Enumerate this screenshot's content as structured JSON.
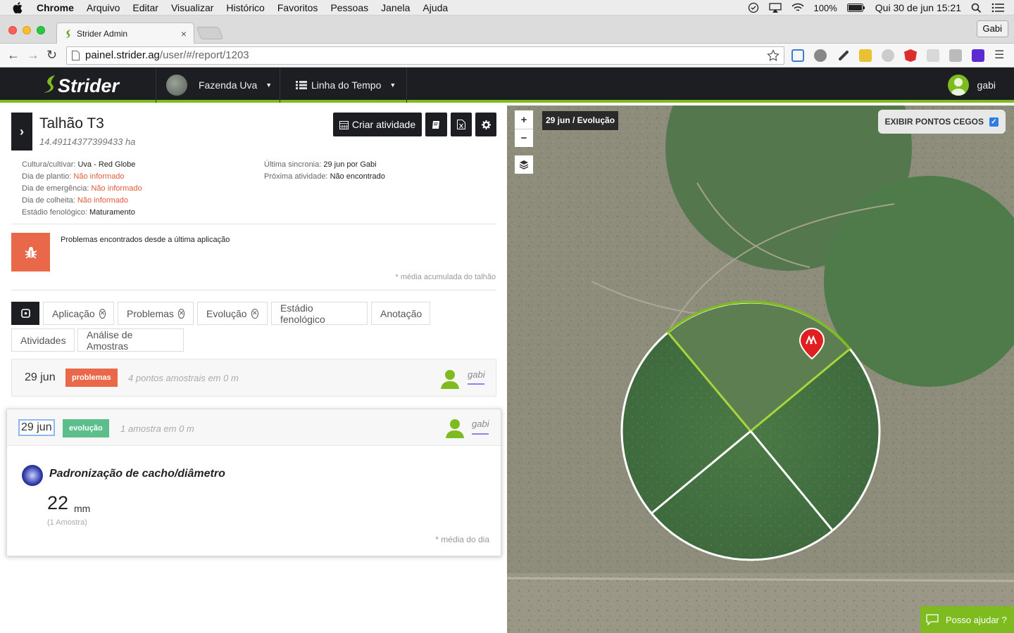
{
  "menubar": {
    "app": "Chrome",
    "items": [
      "Arquivo",
      "Editar",
      "Visualizar",
      "Histórico",
      "Favoritos",
      "Pessoas",
      "Janela",
      "Ajuda"
    ],
    "battery": "100%",
    "clock": "Qui 30 de jun  15:21"
  },
  "browser": {
    "tab_title": "Strider Admin",
    "profile": "Gabi",
    "url_host": "painel.strider.ag",
    "url_path": "/user/#/report/1203"
  },
  "header": {
    "brand": "Strider",
    "farm": "Fazenda Uva",
    "view": "Linha do Tempo",
    "user": "gabi",
    "accent": "#7dbb1f"
  },
  "plot": {
    "title": "Talhão T3",
    "area": "14.49114377399433 ha",
    "create_activity": "Criar atividade",
    "info_left": [
      {
        "label": "Cultura/cultivar:",
        "value": "Uva - Red Globe",
        "warn": false
      },
      {
        "label": "Dia de plantio:",
        "value": "Não informado",
        "warn": true
      },
      {
        "label": "Dia de emergência:",
        "value": "Não informado",
        "warn": true
      },
      {
        "label": "Dia de colheita:",
        "value": "Não informado",
        "warn": true
      },
      {
        "label": "Estádio fenológico:",
        "value": "Maturamento",
        "warn": false
      }
    ],
    "info_right": [
      {
        "label": "Última sincronia:",
        "value": "29 jun por Gabi"
      },
      {
        "label": "Próxima atividade:",
        "value": "Não encontrado"
      }
    ],
    "problems_title": "Problemas encontrados desde a última aplicação",
    "accum_note": "* média acumulada do talhão"
  },
  "filters": {
    "row1": [
      {
        "label": "Aplicação",
        "removable": true
      },
      {
        "label": "Problemas",
        "removable": true
      },
      {
        "label": "Evolução",
        "removable": true
      },
      {
        "label": "Estádio fenológico",
        "removable": false
      },
      {
        "label": "Anotação",
        "removable": false
      }
    ],
    "row2": [
      {
        "label": "Atividades",
        "removable": false
      },
      {
        "label": "Análise de Amostras",
        "removable": false
      }
    ]
  },
  "timeline": [
    {
      "date": "29 jun",
      "badge": "problemas",
      "badge_color": "#e9684a",
      "desc": "4 pontos amostrais em 0 m",
      "user": "gabi"
    },
    {
      "date": "29 jun",
      "badge": "evolução",
      "badge_color": "#5cbf8b",
      "desc": "1 amostra em 0 m",
      "user": "gabi",
      "metric": {
        "title": "Padronização de cacho/diâmetro",
        "value": "22",
        "unit": "mm",
        "count": "(1 Amostra)",
        "note": "* média do dia"
      }
    }
  ],
  "map": {
    "label": "29 jun / Evolução",
    "zoom_in": "+",
    "zoom_out": "−",
    "blind_spots": "EXIBIR PONTOS CEGOS",
    "blind_spots_checked": true,
    "help": "Posso ajudar ?"
  }
}
